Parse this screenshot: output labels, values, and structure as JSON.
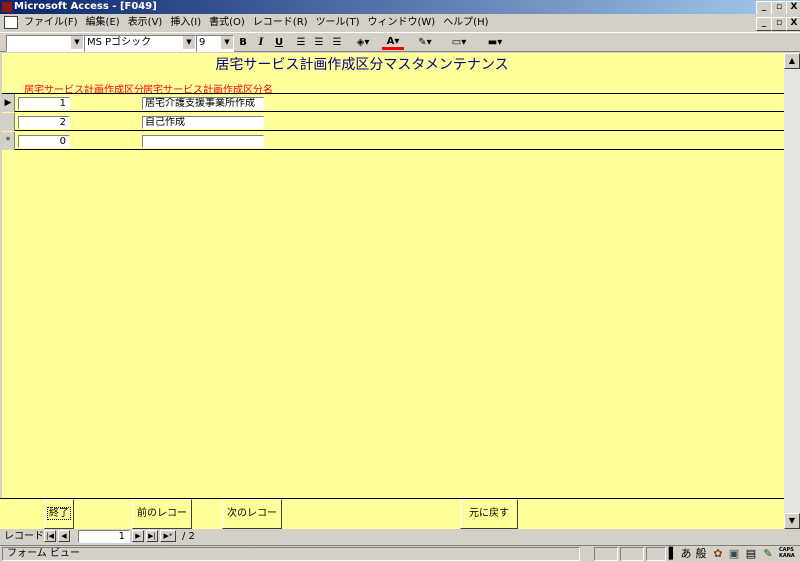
{
  "window": {
    "title": "Microsoft Access - [F049]",
    "minimize_glyph": "_",
    "restore_glyph": "▫",
    "close_glyph": "X"
  },
  "menu": {
    "items": [
      "ファイル(F)",
      "編集(E)",
      "表示(V)",
      "挿入(I)",
      "書式(O)",
      "レコード(R)",
      "ツール(T)",
      "ウィンドウ(W)",
      "ヘルプ(H)"
    ]
  },
  "toolbar": {
    "object_combo": "",
    "font_combo": "MS Pゴシック",
    "size_combo": "9",
    "bold": "B",
    "italic": "I",
    "underline": "U",
    "font_color": "#ff0000"
  },
  "form": {
    "title": "居宅サービス計画作成区分マスタメンテナンス",
    "col_code": "居宅サービス計画作成区分",
    "col_name": "居宅サービス計画作成区分名",
    "rows": [
      {
        "selector": "▶",
        "code": "1",
        "name": "居宅介護支援事業所作成"
      },
      {
        "selector": "",
        "code": "2",
        "name": "自己作成"
      },
      {
        "selector": "*",
        "code": "0",
        "name": ""
      }
    ],
    "background": "#ffff99"
  },
  "footer": {
    "exit_label": "終了",
    "prev_label": "前のレコード",
    "next_label": "次のレコード",
    "undo_label": "元に戻す"
  },
  "nav": {
    "label": "レコード:",
    "current": "1",
    "total": "/ 2"
  },
  "status": {
    "view": "フォーム ビュー",
    "ime_a": "あ",
    "ime_mode": "般",
    "caps": "CAPS",
    "kana": "KANA"
  }
}
